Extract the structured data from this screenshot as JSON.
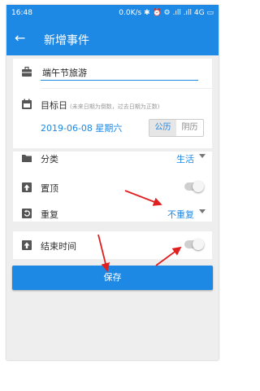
{
  "status_bar": {
    "time": "16:48",
    "right": "0.0K/s ✱ ⏰ ⚙ .ıll .ıll 4G ▭"
  },
  "app_bar": {
    "back_icon": "arrow-left",
    "title": "新增事件"
  },
  "event": {
    "name_value": "端午节旅游"
  },
  "target_date": {
    "label": "目标日",
    "hint": "(未来日期为倒数，过去日期为正数)",
    "date": "2019-06-08 星期六",
    "calendar_options": [
      "公历",
      "阴历"
    ],
    "selected_calendar": "公历"
  },
  "category": {
    "label": "分类",
    "value": "生活"
  },
  "pin_top": {
    "label": "置顶",
    "enabled": false
  },
  "repeat": {
    "label": "重复",
    "value": "不重复"
  },
  "end_time": {
    "label": "结束时间",
    "enabled": false
  },
  "save_label": "保存",
  "colors": {
    "primary": "#1e88e5",
    "background": "#eeeeee",
    "annotation_arrow": "#e02020"
  }
}
